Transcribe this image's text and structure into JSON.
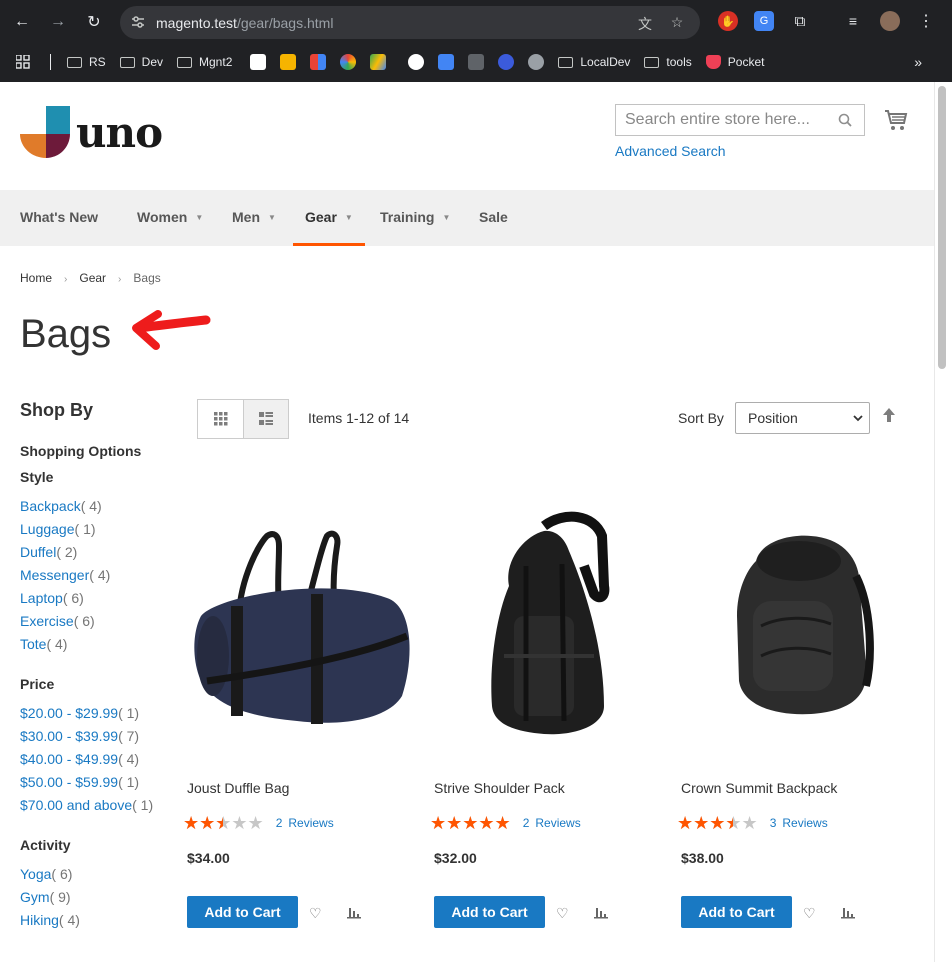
{
  "browser": {
    "url_host": "magento.test",
    "url_path": "/gear/bags.html",
    "bookmarks": [
      "RS",
      "Dev",
      "Mgnt2",
      "LocalDev",
      "tools",
      "Pocket"
    ]
  },
  "header": {
    "logo_text": "uno",
    "search_placeholder": "Search entire store here...",
    "advanced_search": "Advanced Search"
  },
  "nav": {
    "items": [
      {
        "label": "What's New"
      },
      {
        "label": "Women"
      },
      {
        "label": "Men"
      },
      {
        "label": "Gear"
      },
      {
        "label": "Training"
      },
      {
        "label": "Sale"
      }
    ]
  },
  "breadcrumb": {
    "home": "Home",
    "gear": "Gear",
    "current": "Bags"
  },
  "page_title": "Bags",
  "sidebar": {
    "shop_by": "Shop By",
    "shopping_options": "Shopping Options",
    "style": {
      "title": "Style",
      "items": [
        {
          "label": "Backpack",
          "count": "( 4)"
        },
        {
          "label": "Luggage",
          "count": "( 1)"
        },
        {
          "label": "Duffel",
          "count": "( 2)"
        },
        {
          "label": "Messenger",
          "count": "( 4)"
        },
        {
          "label": "Laptop",
          "count": "( 6)"
        },
        {
          "label": "Exercise",
          "count": "( 6)"
        },
        {
          "label": "Tote",
          "count": "( 4)"
        }
      ]
    },
    "price": {
      "title": "Price",
      "items": [
        {
          "label": "$20.00 - $29.99",
          "count": "( 1)"
        },
        {
          "label": "$30.00 - $39.99",
          "count": "( 7)"
        },
        {
          "label": "$40.00 - $49.99",
          "count": "( 4)"
        },
        {
          "label": "$50.00 - $59.99",
          "count": "( 1)"
        },
        {
          "label": "$70.00 and above",
          "count": "( 1)"
        }
      ]
    },
    "activity": {
      "title": "Activity",
      "items": [
        {
          "label": "Yoga",
          "count": "( 6)"
        },
        {
          "label": "Gym",
          "count": "( 9)"
        },
        {
          "label": "Hiking",
          "count": "( 4)"
        }
      ]
    }
  },
  "toolbar": {
    "items_count": "Items 1-12 of 14",
    "sort_label": "Sort By",
    "sort_value": "Position"
  },
  "products": [
    {
      "name": "Joust Duffle Bag",
      "rating": 0.5,
      "reviews_num": "2",
      "reviews_label": "Reviews",
      "price": "$34.00",
      "add_to_cart": "Add to Cart"
    },
    {
      "name": "Strive Shoulder Pack",
      "rating": 1.0,
      "reviews_num": "2",
      "reviews_label": "Reviews",
      "price": "$32.00",
      "add_to_cart": "Add to Cart"
    },
    {
      "name": "Crown Summit Backpack",
      "rating": 0.7,
      "reviews_num": "3",
      "reviews_label": "Reviews",
      "price": "$38.00",
      "add_to_cart": "Add to Cart"
    }
  ],
  "colors": {
    "link": "#1979c3",
    "accent": "#ff5501",
    "button": "#1979c3"
  }
}
